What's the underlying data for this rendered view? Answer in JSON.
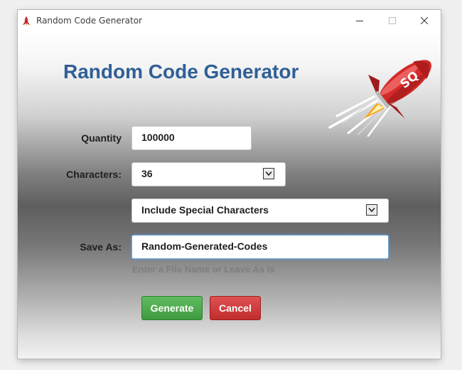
{
  "window": {
    "title": "Random Code Generator",
    "icon": "rocket-icon",
    "controls": [
      "minimize-icon",
      "maximize-icon",
      "close-icon"
    ]
  },
  "header": {
    "heading": "Random Code Generator",
    "logo_text": "SQ"
  },
  "form": {
    "quantity": {
      "label": "Quantity",
      "value": "100000"
    },
    "characters": {
      "label": "Characters:",
      "value": "36"
    },
    "special": {
      "value": "Include Special Characters"
    },
    "save_as": {
      "label": "Save As:",
      "value": "Random-Generated-Codes",
      "hint": "Enter a File Name or Leave As Is"
    }
  },
  "buttons": {
    "generate": "Generate",
    "cancel": "Cancel"
  },
  "colors": {
    "heading": "#2f5f96",
    "generate": "#4cae4c",
    "cancel": "#d43f3f",
    "rocket": "#d42a2a"
  }
}
